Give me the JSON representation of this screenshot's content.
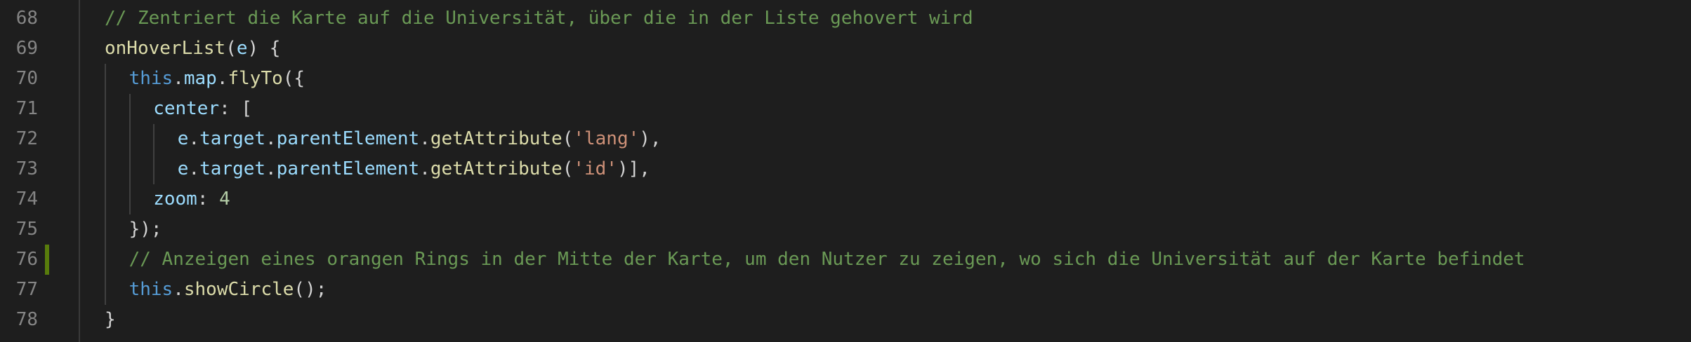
{
  "editor": {
    "line_numbers": [
      "68",
      "69",
      "70",
      "71",
      "72",
      "73",
      "74",
      "75",
      "76",
      "77",
      "78"
    ],
    "git_modified_line": "76",
    "colors": {
      "background": "#1e1e1e",
      "comment": "#6a9955",
      "function": "#dcdcaa",
      "property": "#9cdcfe",
      "keyword": "#569cd6",
      "string": "#ce9178",
      "number": "#b5cea8",
      "git_marker": "#587c0c"
    },
    "lines": [
      [
        {
          "t": "// Zentriert die Karte auf die Universität, über die in der Liste gehovert wird",
          "c": "comment"
        }
      ],
      [
        {
          "t": "onHoverList",
          "c": "func"
        },
        {
          "t": "(",
          "c": "punct"
        },
        {
          "t": "e",
          "c": "param"
        },
        {
          "t": ") {",
          "c": "punct"
        }
      ],
      [
        {
          "t": "this",
          "c": "keyword"
        },
        {
          "t": ".",
          "c": "punct"
        },
        {
          "t": "map",
          "c": "prop"
        },
        {
          "t": ".",
          "c": "punct"
        },
        {
          "t": "flyTo",
          "c": "func"
        },
        {
          "t": "({",
          "c": "punct"
        }
      ],
      [
        {
          "t": "center",
          "c": "prop"
        },
        {
          "t": ": [",
          "c": "punct"
        }
      ],
      [
        {
          "t": "e",
          "c": "param"
        },
        {
          "t": ".",
          "c": "punct"
        },
        {
          "t": "target",
          "c": "prop"
        },
        {
          "t": ".",
          "c": "punct"
        },
        {
          "t": "parentElement",
          "c": "prop"
        },
        {
          "t": ".",
          "c": "punct"
        },
        {
          "t": "getAttribute",
          "c": "func"
        },
        {
          "t": "(",
          "c": "punct"
        },
        {
          "t": "'lang'",
          "c": "string"
        },
        {
          "t": "),",
          "c": "punct"
        }
      ],
      [
        {
          "t": "e",
          "c": "param"
        },
        {
          "t": ".",
          "c": "punct"
        },
        {
          "t": "target",
          "c": "prop"
        },
        {
          "t": ".",
          "c": "punct"
        },
        {
          "t": "parentElement",
          "c": "prop"
        },
        {
          "t": ".",
          "c": "punct"
        },
        {
          "t": "getAttribute",
          "c": "func"
        },
        {
          "t": "(",
          "c": "punct"
        },
        {
          "t": "'id'",
          "c": "string"
        },
        {
          "t": ")],",
          "c": "punct"
        }
      ],
      [
        {
          "t": "zoom",
          "c": "prop"
        },
        {
          "t": ": ",
          "c": "punct"
        },
        {
          "t": "4",
          "c": "number"
        }
      ],
      [
        {
          "t": "});",
          "c": "punct"
        }
      ],
      [
        {
          "t": "// Anzeigen eines orangen Rings in der Mitte der Karte, um den Nutzer zu zeigen, wo sich die Universität auf der Karte befindet",
          "c": "comment"
        }
      ],
      [
        {
          "t": "this",
          "c": "keyword"
        },
        {
          "t": ".",
          "c": "punct"
        },
        {
          "t": "showCircle",
          "c": "func"
        },
        {
          "t": "();",
          "c": "punct"
        }
      ],
      [
        {
          "t": "}",
          "c": "punct"
        }
      ]
    ]
  }
}
